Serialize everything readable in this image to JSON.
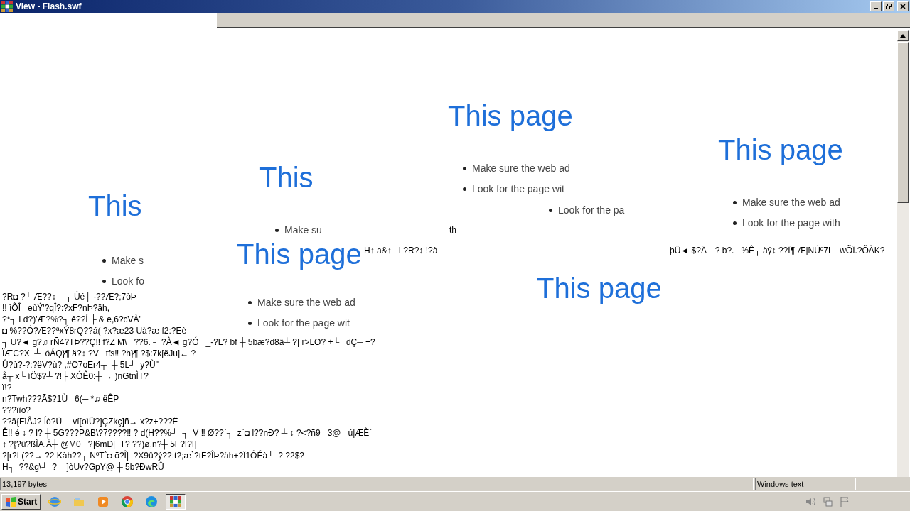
{
  "window": {
    "title": "View - Flash.swf"
  },
  "fragments": [
    {
      "heading": "This",
      "bullets": [
        "Make s",
        "Look fo"
      ]
    },
    {
      "heading": "This",
      "bullets": [
        "Make su"
      ]
    },
    {
      "heading": "This page",
      "bullets": [
        "Make sure the web ad",
        "Look for the page wit"
      ]
    },
    {
      "heading": "This page",
      "bullets": [
        "Make sure the web ad",
        "Look for the page wit"
      ]
    },
    {
      "bullets": [
        "Look for the pa"
      ]
    },
    {
      "heading": "This page"
    },
    {
      "heading": "This page",
      "bullets": [
        "Make sure the web ad",
        "Look for the page with"
      ]
    }
  ],
  "stray_texts": [
    "th",
    "H↑ a&↑   L?R?↕ !?à",
    "þÜ◄ $?Ä┘ ? b?.   %Ê┐ äý↕ ??Ï¶ Æ|NÚº7L   wÕÏ.?ÕÀK?"
  ],
  "text_lines": [
    "?R◘ ?└ Æ??↕    ┐ Ûé├ -??Æ?;7òÞ",
    "!! ìÕÎ   eùÝ'?qÎ?:?xF?nÞ?äh,",
    "?*┐ Ld?)'Æ?%?┐ ê??Í ├ & e,6?cVÀ'",
    "◘ %??Ó?Æ??ªxÝ8rQ??á( ?x?æ23 Uà?æ f2:?Eè",
    "┐ U?◄ g?♫ rÑ4?TÞ??Ç!! f?Z M\\   ??6. ┘ ?À◄ g?Ó   _-?L? bf ┼ 5bæ?d8ä┴ ?| r>LO? +└   dÇ┼ +?",
    "ÏÆC?X  ┴  óÁQ}¶ ä?↕ ?V   tfs‼ ?h}¶ ?$:7k[ëJu]← ?",
    "Û?ù?-?:?ëV?ù? ,#O7oEr4┬  ┼ 5L┘  y?Ù\"",
    "å┬ x└ íÖ$?┴ ?!├ XÓÊ0:┼ → )nGtnÌT?",
    "ï!?",
    "n?Twh???Ã$?1Ù   6(─ *♫ ëÊP",
    "???ïìõ?",
    "??ä{FìÅJ? Íò?Ü┐  ví[oìÜ?]ÇZkç]ñ→ x?z+???Ë",
    "Ê!! é ↕ ? l? ┼ 5G???P&B\\?7????‼ ? d(H??%┘  ┐  V ‼ Ø??`┐  z`◘ l??nÐ? ┴ ↕ ?<?ñ9   3@   ú|ÆÈ`",
    "↕ ?{?ü?ßÌA,Ä┼ @M0   ?]6mÐ|  T? ??)ø,ñ?┼ 5F?í?I]",
    "?[r?L(??→ ?2 Kàh??┬ ÑºT`◘ õ?Î|  ?X9û?ý??:t?;æ`?tF?ÎÞ?äh+?Ï1ÔÉà┘  ? ?2$?",
    "H┐  ??&g\\┘  ?    ]òUv?GpY@ ┼ 5b?ÐwRÛ"
  ],
  "status_bar": {
    "size": "13,197 bytes",
    "mode": "Windows text"
  },
  "taskbar": {
    "start_label": "Start"
  }
}
